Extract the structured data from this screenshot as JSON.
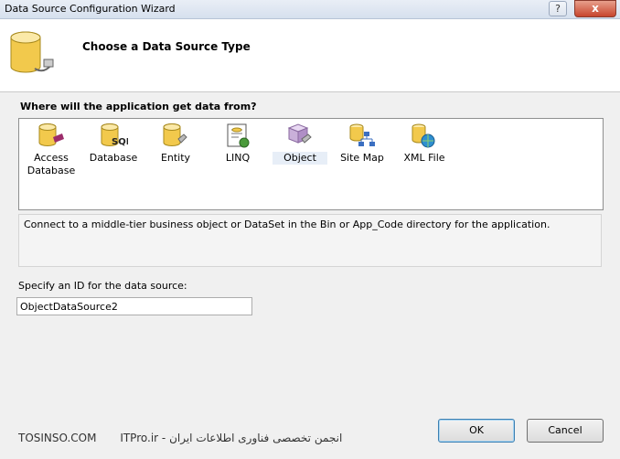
{
  "window": {
    "title": "Data Source Configuration Wizard",
    "help_label": "?",
    "close_label": "x"
  },
  "header": {
    "title": "Choose a Data Source Type"
  },
  "question": {
    "label": "Where will the application get data from?"
  },
  "types": [
    {
      "line1": "Access",
      "line2": "Database",
      "icon": "access-database-icon"
    },
    {
      "line1": "Database",
      "line2": "",
      "icon": "sql-database-icon"
    },
    {
      "line1": "Entity",
      "line2": "",
      "icon": "entity-icon"
    },
    {
      "line1": "LINQ",
      "line2": "",
      "icon": "linq-icon"
    },
    {
      "line1": "Object",
      "line2": "",
      "icon": "object-icon",
      "selected": true
    },
    {
      "line1": "Site Map",
      "line2": "",
      "icon": "site-map-icon"
    },
    {
      "line1": "XML File",
      "line2": "",
      "icon": "xml-file-icon"
    }
  ],
  "description": "Connect to a middle-tier business object or DataSet in the Bin or App_Code directory for the application.",
  "id_field": {
    "label": "Specify an ID for the data source:",
    "value": "ObjectDataSource2"
  },
  "watermark": {
    "site": "TOSINSO.COM",
    "text": "ITPro.ir - انجمن تخصصی فناوری اطلاعات ایران"
  },
  "buttons": {
    "ok": "OK",
    "cancel": "Cancel"
  }
}
